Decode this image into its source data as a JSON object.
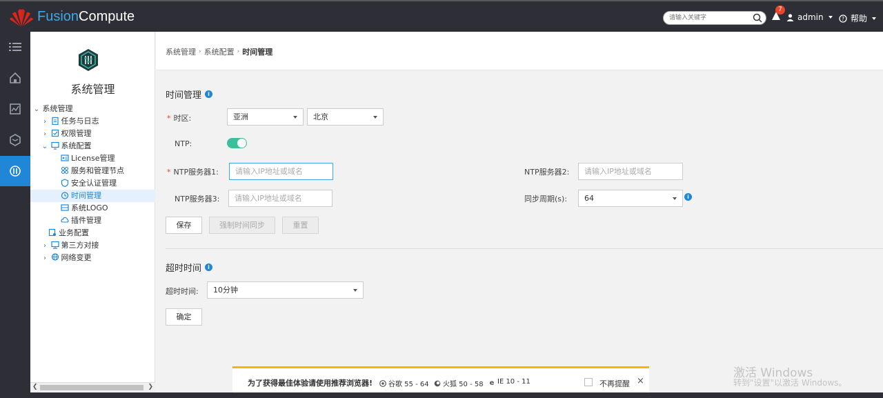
{
  "header": {
    "brand_part1": "Fusion",
    "brand_part2": "Compute",
    "search_placeholder": "请输入关键字",
    "alert_count": "7",
    "user": "admin",
    "help": "帮助"
  },
  "rail": {
    "items": [
      "menu-icon",
      "home-icon",
      "monitor-icon",
      "resource-icon",
      "system-icon"
    ],
    "active_color": "#1f86d8"
  },
  "sidebar": {
    "title": "系统管理",
    "tree": [
      {
        "label": "系统管理",
        "level": 0,
        "arrow": "open"
      },
      {
        "label": "任务与日志",
        "level": 1,
        "arrow": "closed"
      },
      {
        "label": "权限管理",
        "level": 1,
        "arrow": "closed"
      },
      {
        "label": "系统配置",
        "level": 1,
        "arrow": "open"
      },
      {
        "label": "License管理",
        "level": 2
      },
      {
        "label": "服务和管理节点",
        "level": 2
      },
      {
        "label": "安全认证管理",
        "level": 2
      },
      {
        "label": "时间管理",
        "level": 2,
        "selected": true
      },
      {
        "label": "系统LOGO",
        "level": 2
      },
      {
        "label": "插件管理",
        "level": 2
      },
      {
        "label": "业务配置",
        "level": 1
      },
      {
        "label": "第三方对接",
        "level": 1,
        "arrow": "closed"
      },
      {
        "label": "网络变更",
        "level": 1,
        "arrow": "closed"
      }
    ]
  },
  "breadcrumb": {
    "items": [
      "系统管理",
      "系统配置"
    ],
    "current": "时间管理"
  },
  "time_section": {
    "title": "时间管理",
    "timezone_label": "时区:",
    "timezone_region": "亚洲",
    "timezone_city": "北京",
    "ntp_label": "NTP:",
    "ntp_enabled": true,
    "ntp1_label": "NTP服务器1:",
    "ntp2_label": "NTP服务器2:",
    "ntp3_label": "NTP服务器3:",
    "ntp_placeholder": "请输入IP地址或域名",
    "sync_period_label": "同步周期(s):",
    "sync_period_value": "64",
    "save_label": "保存",
    "force_sync_label": "强制时间同步",
    "reset_label": "重置"
  },
  "timeout_section": {
    "title": "超时时间",
    "timeout_label": "超时时间:",
    "timeout_value": "10分钟",
    "confirm_label": "确定"
  },
  "notice": {
    "text": "为了获得最佳体验请使用推荐浏览器!",
    "chrome": "谷歌 55 - 64",
    "firefox": "火狐 50 - 58",
    "ie": "IE 10 - 11",
    "no_remind": "不再提醒",
    "close": "×"
  },
  "watermark": {
    "line1": "激活 Windows",
    "line2": "转到\"设置\"以激活 Windows。"
  }
}
